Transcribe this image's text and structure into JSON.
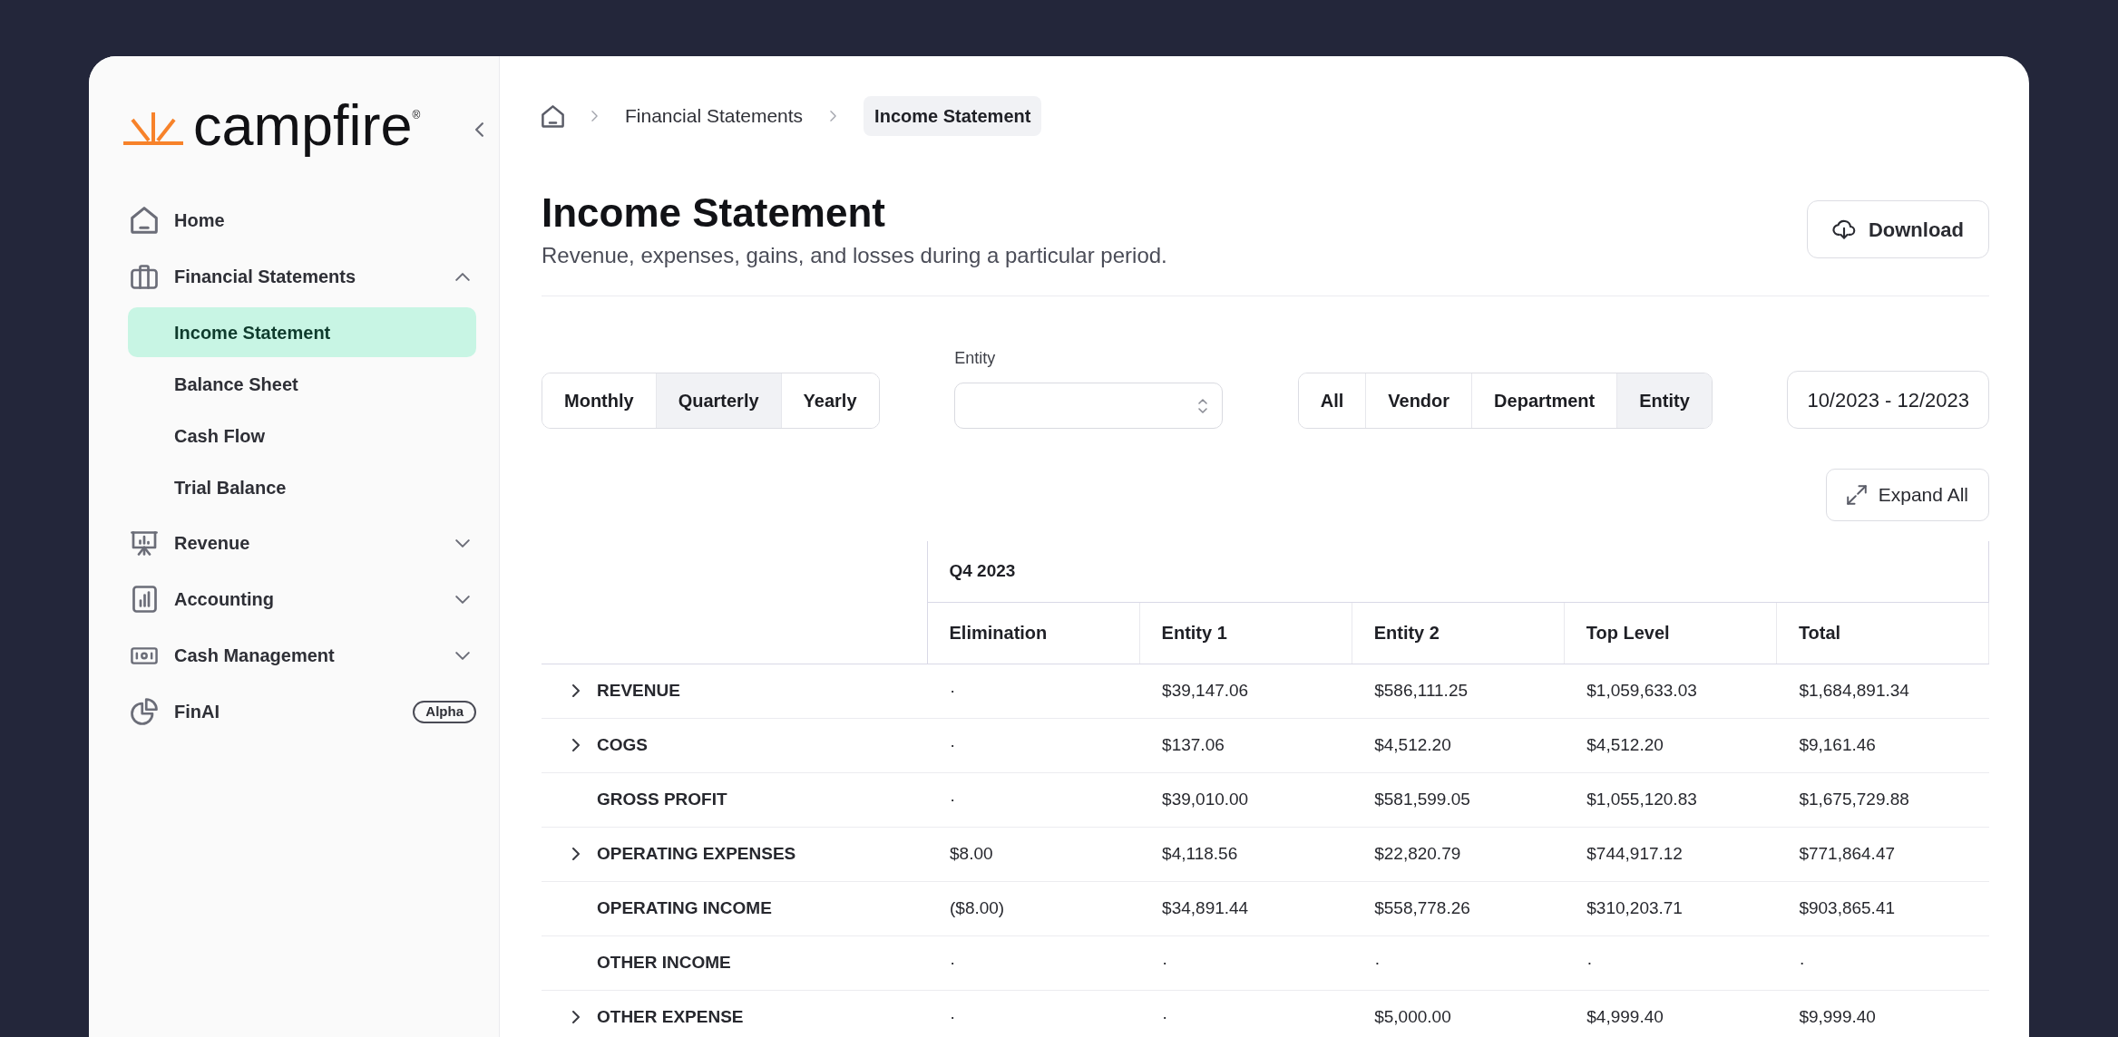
{
  "sidebar": {
    "logo": "campfire$^{®}$",
    "items": [
      {
        "kind": "link",
        "label": "Home"
      },
      {
        "kind": "group",
        "label": "Financial Statements",
        "expanded": true,
        "children": [
          {
            "label": "Income Statement",
            "selected": true
          },
          {
            "label": "Balance Sheet",
            "selected": false
          },
          {
            "label": "Cash Flow",
            "selected": false
          },
          {
            "label": "Trial Balance",
            "selected": false
          }
        ]
      },
      {
        "kind": "group",
        "label": "Revenue",
        "expanded": false
      },
      {
        "kind": "group",
        "label": "Accounting",
        "expanded": false
      },
      {
        "kind": "group",
        "label": "Cash Management",
        "expanded": false
      },
      {
        "kind": "link",
        "label": "FinAI",
        "badge": "Alpha"
      }
    ]
  },
  "breadcrumbs": [
    {
      "label": "Financial Statements",
      "current": false
    },
    {
      "label": "Income Statement",
      "current": true
    }
  ],
  "header": {
    "title": "Income Statement",
    "subtitle": "Revenue, expenses, gains, and losses during a particular period.",
    "download_button": "Download"
  },
  "filters": {
    "period_tabs": [
      {
        "label": "Monthly",
        "selected": false
      },
      {
        "label": "Quarterly",
        "selected": true
      },
      {
        "label": "Yearly",
        "selected": false
      }
    ],
    "entity_select": {
      "label": "Entity"
    },
    "group_tabs": [
      {
        "label": "All",
        "selected": false
      },
      {
        "label": "Vendor",
        "selected": false
      },
      {
        "label": "Department",
        "selected": false
      },
      {
        "label": "Entity",
        "selected": true
      }
    ],
    "date_range": "10/2023 - 12/2023"
  },
  "expand_all_button": "Expand All",
  "table": {
    "column_group": "Q4 2023",
    "columns": [
      "Elimination",
      "Entity 1",
      "Entity 2",
      "Top Level",
      "Total"
    ],
    "rows": [
      {
        "label": "REVENUE",
        "expandable": true,
        "cells": [
          "·",
          "$39,147.06",
          "$586,111.25",
          "$1,059,633.03",
          "$1,684,891.34"
        ]
      },
      {
        "label": "COGS",
        "expandable": true,
        "cells": [
          "·",
          "$137.06",
          "$4,512.20",
          "$4,512.20",
          "$9,161.46"
        ]
      },
      {
        "label": "GROSS PROFIT",
        "expandable": false,
        "cells": [
          "·",
          "$39,010.00",
          "$581,599.05",
          "$1,055,120.83",
          "$1,675,729.88"
        ]
      },
      {
        "label": "OPERATING EXPENSES",
        "expandable": true,
        "cells": [
          "$8.00",
          "$4,118.56",
          "$22,820.79",
          "$744,917.12",
          "$771,864.47"
        ]
      },
      {
        "label": "OPERATING INCOME",
        "expandable": false,
        "cells": [
          "($8.00)",
          "$34,891.44",
          "$558,778.26",
          "$310,203.71",
          "$903,865.41"
        ]
      },
      {
        "label": "OTHER INCOME",
        "expandable": false,
        "cells": [
          "·",
          "·",
          "·",
          "·",
          "·"
        ]
      },
      {
        "label": "OTHER EXPENSE",
        "expandable": true,
        "cells": [
          "·",
          "·",
          "$5,000.00",
          "$4,999.40",
          "$9,999.40"
        ]
      }
    ]
  }
}
